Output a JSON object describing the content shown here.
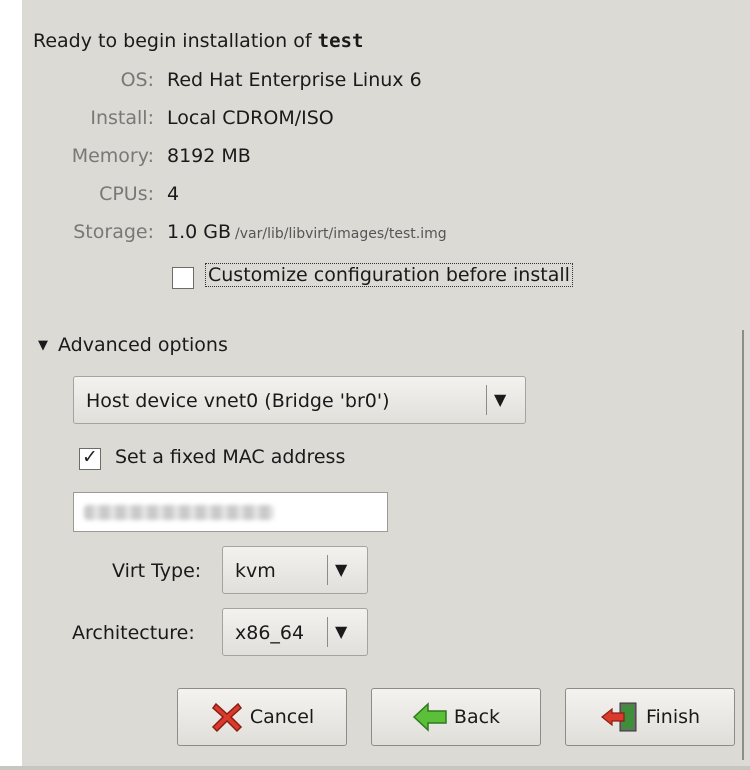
{
  "summary": {
    "heading_prefix": "Ready to begin installation of ",
    "vm_name": "test",
    "rows": [
      {
        "label": "OS:",
        "value": "Red Hat Enterprise Linux 6"
      },
      {
        "label": "Install:",
        "value": "Local CDROM/ISO"
      },
      {
        "label": "Memory:",
        "value": "8192 MB"
      },
      {
        "label": "CPUs:",
        "value": "4"
      },
      {
        "label": "Storage:",
        "value": "1.0 GB",
        "detail": "/var/lib/libvirt/images/test.img"
      }
    ]
  },
  "customize_checkbox": {
    "label": "Customize configuration before install",
    "checked": false
  },
  "advanced": {
    "expander_label": "Advanced options",
    "expanded": true,
    "network_select": "Host device vnet0 (Bridge 'br0')",
    "mac_checkbox": {
      "label": "Set a fixed MAC address",
      "checked": true
    },
    "mac_value": "",
    "virt_type": {
      "label": "Virt Type:",
      "value": "kvm"
    },
    "architecture": {
      "label": "Architecture:",
      "value": "x86_64"
    }
  },
  "buttons": {
    "cancel": "Cancel",
    "back": "Back",
    "finish": "Finish"
  },
  "colors": {
    "background": "#dcdad5",
    "cancel_icon": "#d93a2b",
    "back_icon": "#5bbf3a",
    "finish_icon": "#d93a2b"
  }
}
